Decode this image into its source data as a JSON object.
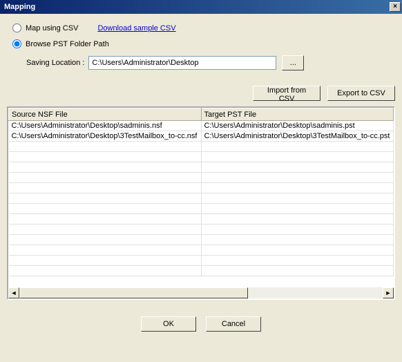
{
  "window": {
    "title": "Mapping",
    "close_icon": "×"
  },
  "options": {
    "map_csv_label": "Map using CSV",
    "download_link": "Download sample CSV",
    "browse_label": "Browse PST Folder Path",
    "saving_location_label": "Saving Location :",
    "saving_location_value": "C:\\Users\\Administrator\\Desktop",
    "browse_button": "...",
    "selected": "browse"
  },
  "actions": {
    "import_label": "Import from CSV",
    "export_label": "Export to CSV"
  },
  "grid": {
    "headers": {
      "source": "Source NSF File",
      "target": "Target PST File"
    },
    "rows": [
      {
        "source": "C:\\Users\\Administrator\\Desktop\\sadminis.nsf",
        "target": "C:\\Users\\Administrator\\Desktop\\sadminis.pst"
      },
      {
        "source": "C:\\Users\\Administrator\\Desktop\\3TestMailbox_to-cc.nsf",
        "target": "C:\\Users\\Administrator\\Desktop\\3TestMailbox_to-cc.pst"
      }
    ]
  },
  "footer": {
    "ok": "OK",
    "cancel": "Cancel"
  },
  "scroll": {
    "left": "◄",
    "right": "►"
  }
}
